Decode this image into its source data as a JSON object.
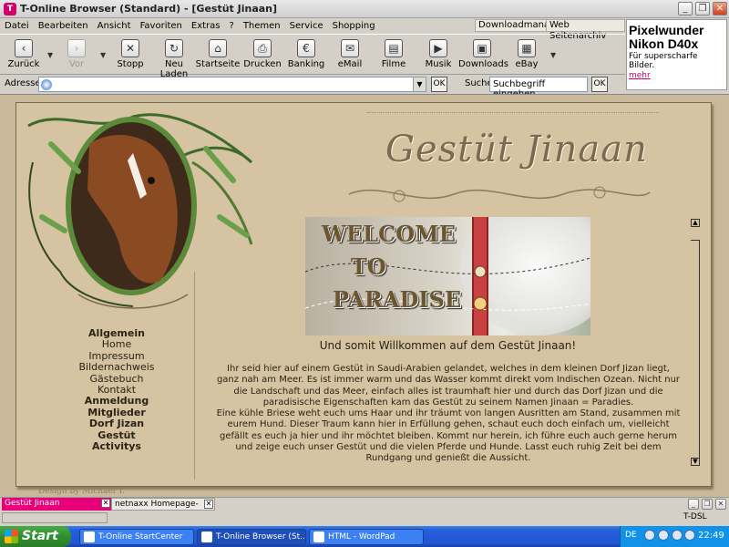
{
  "window": {
    "title": "T-Online Browser (Standard) - [Gestüt Jinaan]",
    "app_icon": "T",
    "controls": {
      "minimize": "_",
      "maximize": "❐",
      "close": "✕"
    }
  },
  "menu": {
    "items": [
      "Datei",
      "Bearbeiten",
      "Ansicht",
      "Favoriten",
      "Extras",
      "?",
      "Themen",
      "Service",
      "Shopping"
    ],
    "downloadmanager": "Downloadmanager",
    "archive": "Web Seitenarchiv"
  },
  "ad": {
    "headline": "Pixelwunder Nikon D40x",
    "sub": "Für superscharfe Bilder.",
    "more": "mehr"
  },
  "toolbar": {
    "buttons": [
      {
        "label": "Zurück",
        "icon": "‹"
      },
      {
        "label": "Vor",
        "icon": "›"
      },
      {
        "label": "Stopp",
        "icon": "✕"
      },
      {
        "label": "Neu Laden",
        "icon": "↻"
      },
      {
        "label": "Startseite",
        "icon": "⌂"
      },
      {
        "label": "Drucken",
        "icon": "⎙"
      },
      {
        "label": "Banking",
        "icon": "€"
      },
      {
        "label": "eMail",
        "icon": "✉"
      },
      {
        "label": "Filme",
        "icon": "▤"
      },
      {
        "label": "Musik",
        "icon": "▶"
      },
      {
        "label": "Downloads",
        "icon": "▣"
      },
      {
        "label": "eBay",
        "icon": "▦"
      }
    ],
    "dropdown": "▼"
  },
  "address": {
    "label": "Adresse",
    "value": "",
    "ok": "OK",
    "search_label": "Suche",
    "search_placeholder": "Suchbegriff eingeben",
    "search_ok": "OK"
  },
  "page": {
    "site_title": "Gestüt Jinaan",
    "banner": [
      "WELCOME",
      "TO",
      "PARADISE"
    ],
    "subtitle": "Und somit Willkommen auf dem Gestüt Jinaan!",
    "nav": [
      {
        "label": "Allgemein",
        "bold": true
      },
      {
        "label": "Home",
        "bold": false
      },
      {
        "label": "Impressum",
        "bold": false
      },
      {
        "label": "Bildernachweis",
        "bold": false
      },
      {
        "label": "Gästebuch",
        "bold": false
      },
      {
        "label": "Kontakt",
        "bold": false
      },
      {
        "label": "Anmeldung",
        "bold": true
      },
      {
        "label": "Mitglieder",
        "bold": true
      },
      {
        "label": "Dorf Jizan",
        "bold": true
      },
      {
        "label": "Gestüt",
        "bold": true
      },
      {
        "label": "Activitys",
        "bold": true
      }
    ],
    "body_p1": "Ihr seid hier auf einem Gestüt in Saudi-Arabien gelandet, welches in dem kleinen Dorf Jizan liegt, ganz nah am Meer. Es ist immer warm und das Wasser kommt direkt vom Indischen Ozean. Nicht nur die Landschaft und das Meer, einfach alles ist traumhaft hier und durch das Dorf Jizan und die paradisische Eigenschaften kam das Gestüt zu seinem Namen Jinaan = Paradies.",
    "body_p2": "Eine kühle Briese weht euch ums Haar und ihr träumt von langen Ausritten am Stand, zusammen mit eurem Hund. Dieser Traum kann hier in Erfüllung gehen, schaut euch doch einfach um, vielleicht gefällt es euch ja hier und ihr möchtet bleiben. Kommt nur herein, ich führe euch auch gerne herum und zeige euch unser Gestüt und die vielen Pferde und Hunde. Lasst euch ruhig Zeit bei dem Rundgang und genießt die Aussicht.",
    "credit": "Design by Michael T.",
    "scroll_up": "▲",
    "scroll_down": "▼"
  },
  "tabs": [
    {
      "label": "Gestüt Jinaan",
      "active": true,
      "close": "✕"
    },
    {
      "label": "netnaxx Homepage-Mak...",
      "active": false,
      "close": "✕"
    }
  ],
  "status": {
    "connection": "T-DSL"
  },
  "taskbar": {
    "start": "Start",
    "tasks": [
      {
        "label": "T-Online StartCenter",
        "active": false
      },
      {
        "label": "T-Online Browser (St...",
        "active": true
      },
      {
        "label": "HTML - WordPad",
        "active": false
      }
    ],
    "lang": "DE",
    "clock": "22:49"
  },
  "colors": {
    "accent": "#d1006b",
    "page_bg": "#d5c3a1",
    "taskbar": "#245edb"
  }
}
